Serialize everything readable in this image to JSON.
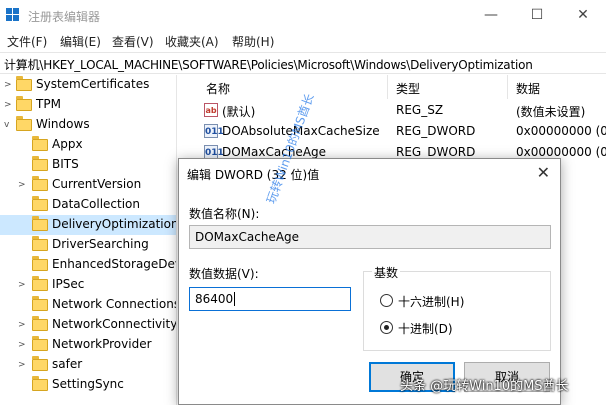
{
  "window": {
    "title": "注册表编辑器",
    "min": "—",
    "max": "☐",
    "close": "✕"
  },
  "menu": [
    "文件(F)",
    "编辑(E)",
    "查看(V)",
    "收藏夹(A)",
    "帮助(H)"
  ],
  "address": "计算机\\HKEY_LOCAL_MACHINE\\SOFTWARE\\Policies\\Microsoft\\Windows\\DeliveryOptimization",
  "tree": [
    {
      "label": "SystemCertificates",
      "expander": ">"
    },
    {
      "label": "TPM",
      "expander": ">"
    },
    {
      "label": "Windows",
      "expander": "v"
    },
    {
      "label": "Appx",
      "expander": ""
    },
    {
      "label": "BITS",
      "expander": ""
    },
    {
      "label": "CurrentVersion",
      "expander": ">"
    },
    {
      "label": "DataCollection",
      "expander": ""
    },
    {
      "label": "DeliveryOptimization",
      "expander": ""
    },
    {
      "label": "DriverSearching",
      "expander": ""
    },
    {
      "label": "EnhancedStorageDev",
      "expander": ""
    },
    {
      "label": "IPSec",
      "expander": ">"
    },
    {
      "label": "Network Connections",
      "expander": ""
    },
    {
      "label": "NetworkConnectivityS",
      "expander": ">"
    },
    {
      "label": "NetworkProvider",
      "expander": ">"
    },
    {
      "label": "safer",
      "expander": ">"
    },
    {
      "label": "SettingSync",
      "expander": ""
    }
  ],
  "list": {
    "headers": [
      "名称",
      "类型",
      "数据"
    ],
    "rows": [
      {
        "icon": "ab",
        "name": "(默认)",
        "type": "REG_SZ",
        "data": "(数值未设置)"
      },
      {
        "icon": "011",
        "name": "DOAbsoluteMaxCacheSize",
        "type": "REG_DWORD",
        "data": "0x00000000 (0)"
      },
      {
        "icon": "011",
        "name": "DOMaxCacheAge",
        "type": "REG_DWORD",
        "data": "0x00000000 (0)"
      }
    ]
  },
  "dialog": {
    "title": "编辑 DWORD (32 位)值",
    "close": "✕",
    "name_label": "数值名称(N):",
    "name_value": "DOMaxCacheAge",
    "data_label": "数值数据(V):",
    "data_value": "86400",
    "base_label": "基数",
    "hex_label": "十六进制(H)",
    "dec_label": "十进制(D)",
    "selected_base": "dec",
    "ok": "确定",
    "cancel": "取消"
  },
  "watermarks": {
    "vertical": "玩转Win10的MS酋长",
    "bar": "头条 @玩转Win10的MS酋长"
  }
}
